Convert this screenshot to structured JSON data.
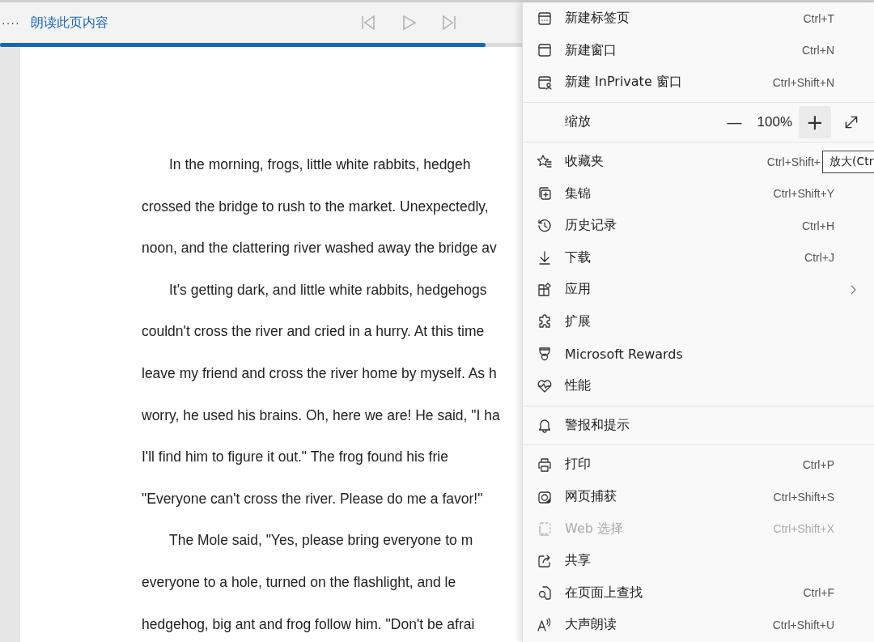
{
  "toolbar": {
    "more": "····",
    "title": "朗读此页内容",
    "progress": {
      "level": 0.93
    }
  },
  "document": {
    "paragraphs": [
      {
        "lines": [
          "In the morning, frogs, little white rabbits, hedgeh",
          "crossed the bridge to rush to the market. Unexpectedly,",
          "noon, and the clattering river washed away the bridge av"
        ]
      },
      {
        "lines": [
          "It's getting dark, and little white rabbits, hedgehogs",
          "couldn't cross the river and cried in a hurry. At this time",
          "leave my friend and cross the river home by myself. As h",
          "worry, he used his brains. Oh, here we are! He said, \"I ha",
          "I'll find him to figure it out.\" The frog found his frie",
          "\"Everyone can't cross the river. Please do me a favor!\""
        ]
      },
      {
        "lines": [
          "The Mole said, \"Yes, please bring everyone to m",
          "everyone to a hole, turned on the flashlight, and le",
          "hedgehog, big ant and frog follow him. \"Don't be afrai"
        ]
      }
    ]
  },
  "menu": {
    "items": [
      {
        "kind": "item",
        "label": "新建标签页",
        "shortcut": "Ctrl+T",
        "disabled": false
      },
      {
        "kind": "item",
        "label": "新建窗口",
        "shortcut": "Ctrl+N",
        "disabled": false
      },
      {
        "kind": "item",
        "label": "新建 InPrivate 窗口",
        "shortcut": "Ctrl+Shift+N",
        "disabled": false
      },
      {
        "kind": "separator"
      },
      {
        "kind": "zoom",
        "label": "缩放",
        "minus": "—",
        "value": "100%",
        "plus": "+"
      },
      {
        "kind": "separator"
      },
      {
        "kind": "item",
        "label": "收藏夹",
        "shortcut": "Ctrl+Shift+",
        "disabled": false,
        "tooltip": "放大(Ctr"
      },
      {
        "kind": "item",
        "label": "集锦",
        "shortcut": "Ctrl+Shift+Y",
        "disabled": false
      },
      {
        "kind": "item",
        "label": "历史记录",
        "shortcut": "Ctrl+H",
        "disabled": false
      },
      {
        "kind": "item",
        "label": "下载",
        "shortcut": "Ctrl+J",
        "disabled": false
      },
      {
        "kind": "item",
        "label": "应用",
        "submenu": true,
        "disabled": false
      },
      {
        "kind": "item",
        "label": "扩展",
        "disabled": false
      },
      {
        "kind": "item",
        "label": "Microsoft Rewards",
        "disabled": false
      },
      {
        "kind": "item",
        "label": "性能",
        "disabled": false
      },
      {
        "kind": "separator"
      },
      {
        "kind": "item",
        "label": "警报和提示",
        "disabled": false
      },
      {
        "kind": "separator"
      },
      {
        "kind": "item",
        "label": "打印",
        "shortcut": "Ctrl+P",
        "disabled": false
      },
      {
        "kind": "item",
        "label": "网页捕获",
        "shortcut": "Ctrl+Shift+S",
        "disabled": false
      },
      {
        "kind": "item",
        "label": "Web 选择",
        "shortcut": "Ctrl+Shift+X",
        "disabled": true
      },
      {
        "kind": "item",
        "label": "共享",
        "disabled": false
      },
      {
        "kind": "item",
        "label": "在页面上查找",
        "shortcut": "Ctrl+F",
        "disabled": false
      },
      {
        "kind": "item",
        "label": "大声朗读",
        "shortcut": "Ctrl+Shift+U",
        "disabled": false
      }
    ]
  }
}
